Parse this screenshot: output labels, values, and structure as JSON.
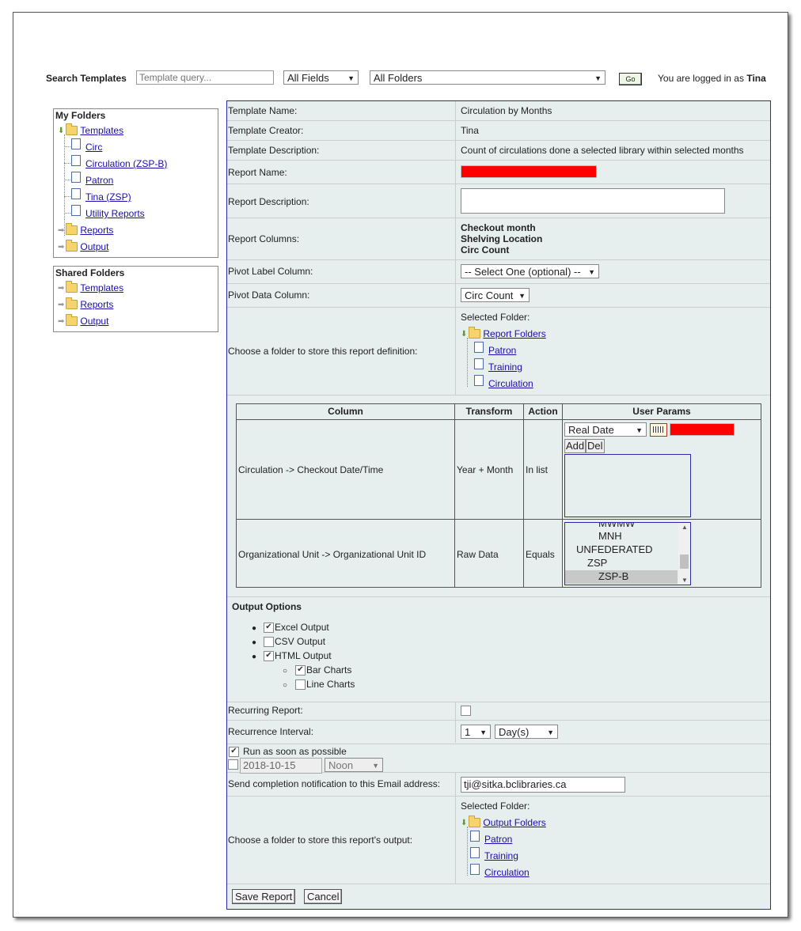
{
  "header": {
    "search_label": "Search Templates",
    "search_placeholder": "Template query...",
    "fields_select": "All Fields",
    "folders_select": "All Folders",
    "go_label": "Go",
    "login_prefix": "You are logged in as",
    "login_user": "Tina"
  },
  "my_folders": {
    "title": "My Folders",
    "templates_label": "Templates",
    "template_items": [
      "Circ",
      "Circulation (ZSP-B)",
      "Patron",
      "Tina (ZSP)",
      "Utility Reports"
    ],
    "reports_label": "Reports",
    "output_label": "Output"
  },
  "shared_folders": {
    "title": "Shared Folders",
    "templates_label": "Templates",
    "reports_label": "Reports",
    "output_label": "Output"
  },
  "form": {
    "template_name_label": "Template Name:",
    "template_name": "Circulation by Months",
    "template_creator_label": "Template Creator:",
    "template_creator": "Tina",
    "template_description_label": "Template Description:",
    "template_description": "Count of circulations done a selected library within selected months",
    "report_name_label": "Report Name:",
    "report_description_label": "Report Description:",
    "report_columns_label": "Report Columns:",
    "report_columns": [
      "Checkout month",
      "Shelving Location",
      "Circ Count"
    ],
    "pivot_label_label": "Pivot Label Column:",
    "pivot_label_value": "-- Select One (optional) --",
    "pivot_data_label": "Pivot Data Column:",
    "pivot_data_value": "Circ Count",
    "folder_label": "Choose a folder to store this report definition:",
    "selected_folder_label": "Selected Folder:",
    "report_folders_label": "Report Folders",
    "report_folder_items": [
      "Patron",
      "Training",
      "Circulation"
    ]
  },
  "params_table": {
    "headers": [
      "Column",
      "Transform",
      "Action",
      "User Params"
    ],
    "rows": [
      {
        "column": "Circulation -> Checkout Date/Time",
        "transform": "Year + Month",
        "action": "In list"
      },
      {
        "column": "Organizational Unit -> Organizational Unit ID",
        "transform": "Raw Data",
        "action": "Equals"
      }
    ],
    "date_type_select": "Real Date",
    "add_label": "Add",
    "del_label": "Del",
    "org_units": [
      "MWMW",
      "MNH",
      "UNFEDERATED",
      "ZSP",
      "ZSP-B"
    ]
  },
  "output_options": {
    "title": "Output Options",
    "excel": "Excel Output",
    "csv": "CSV Output",
    "html": "HTML Output",
    "bar_charts": "Bar Charts",
    "line_charts": "Line Charts"
  },
  "schedule": {
    "recurring_label": "Recurring Report:",
    "interval_label": "Recurrence Interval:",
    "interval_num": "1",
    "interval_unit": "Day(s)",
    "run_asap_label": "Run as soon as possible",
    "date_value": "2018-10-15",
    "time_value": "Noon",
    "email_label": "Send completion notification to this Email address:",
    "email_value": "tji@sitka.bclibraries.ca",
    "output_folder_label": "Choose a folder to store this report's output:",
    "selected_folder_label": "Selected Folder:",
    "output_folders_label": "Output Folders",
    "output_folder_items": [
      "Patron",
      "Training",
      "Circulation"
    ]
  },
  "actions": {
    "save_label": "Save Report",
    "cancel_label": "Cancel"
  },
  "colors": {
    "accent_border": "#2a2aa8",
    "panel_bg": "#e7efee",
    "required_field": "#ff0000",
    "link": "#1a0dab"
  }
}
